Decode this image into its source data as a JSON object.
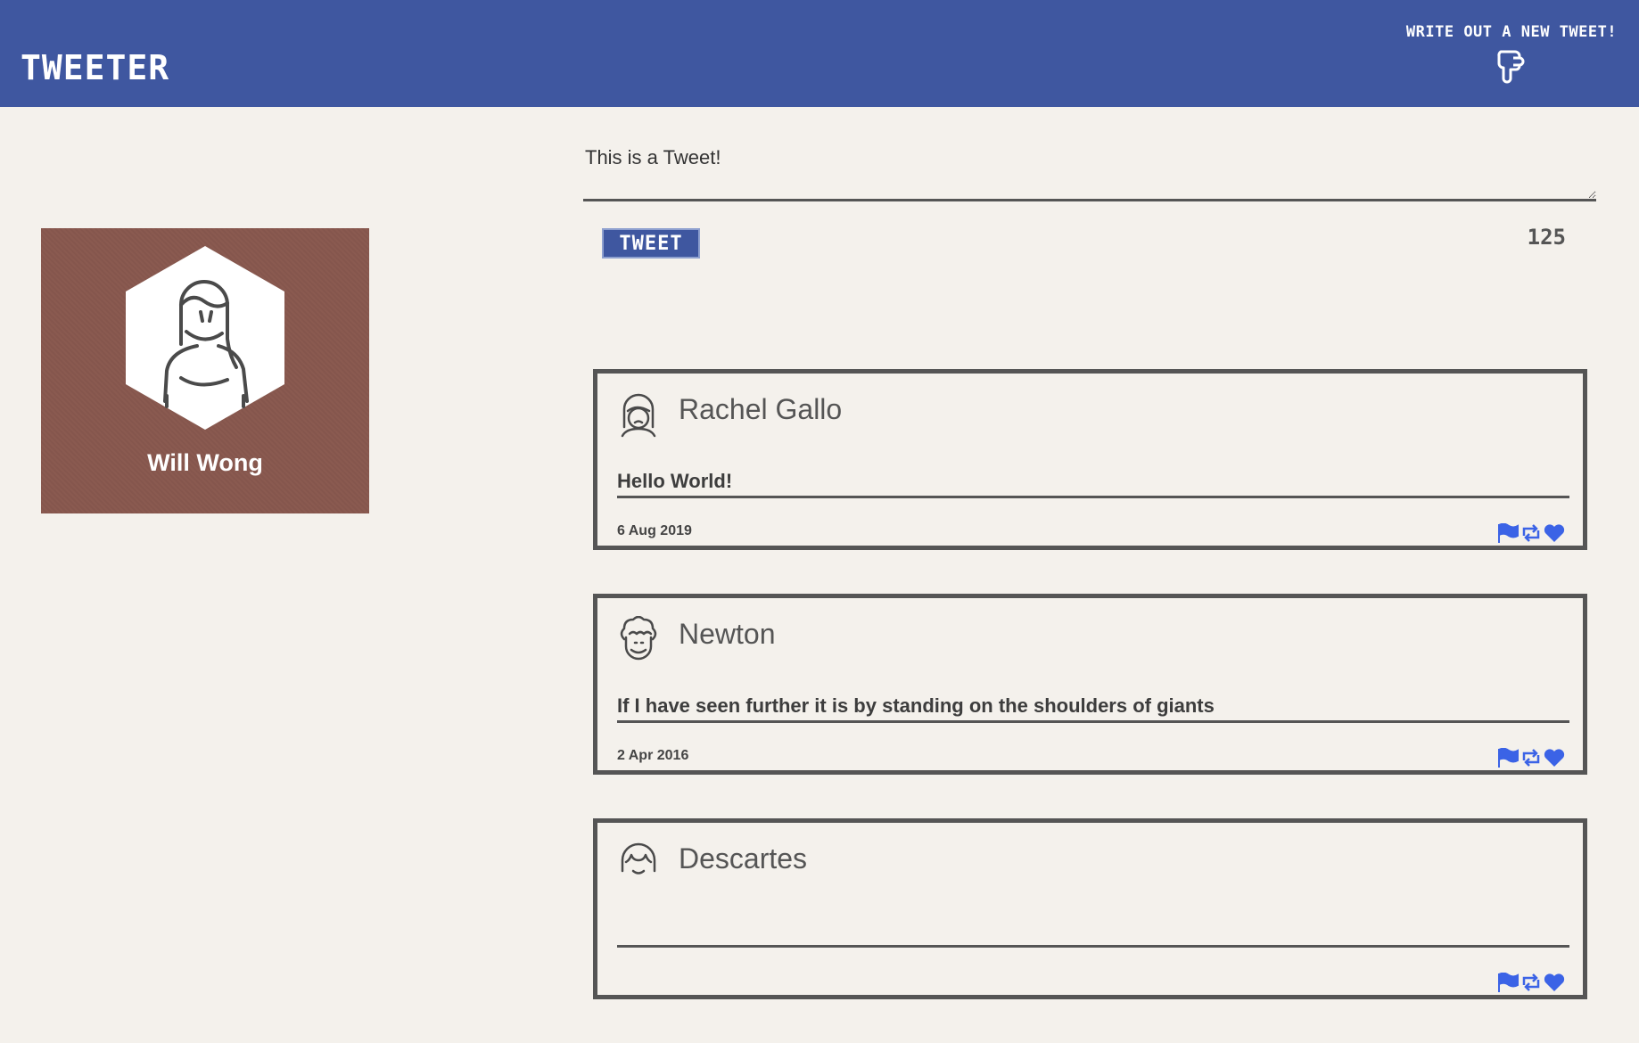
{
  "header": {
    "brand": "TWEETER",
    "compose_label": "WRITE OUT A NEW TWEET!",
    "compose_icon": "pointing-down-hand-icon"
  },
  "profile": {
    "name": "Will Wong",
    "avatar_icon": "woman-avatar-icon",
    "background_color": "#8a5a50"
  },
  "composer": {
    "text": "This is a Tweet!",
    "button_label": "TWEET",
    "counter": "125"
  },
  "colors": {
    "nav": "#3f57a0",
    "page_background": "#f4f1ec",
    "action_icons": "#3b63e6"
  },
  "tweets": [
    {
      "author": "Rachel Gallo",
      "avatar_icon": "woman-avatar-icon",
      "content": "Hello World!",
      "date": "6 Aug 2019",
      "actions": [
        "flag-icon",
        "retweet-icon",
        "heart-icon"
      ]
    },
    {
      "author": "Newton",
      "avatar_icon": "curly-hair-man-avatar-icon",
      "content": "If I have seen further it is by standing on the shoulders of giants",
      "date": "2 Apr 2016",
      "actions": [
        "flag-icon",
        "retweet-icon",
        "heart-icon"
      ]
    },
    {
      "author": "Descartes",
      "avatar_icon": "bangs-avatar-icon",
      "content": "",
      "date": "",
      "actions": [
        "flag-icon",
        "retweet-icon",
        "heart-icon"
      ]
    }
  ]
}
